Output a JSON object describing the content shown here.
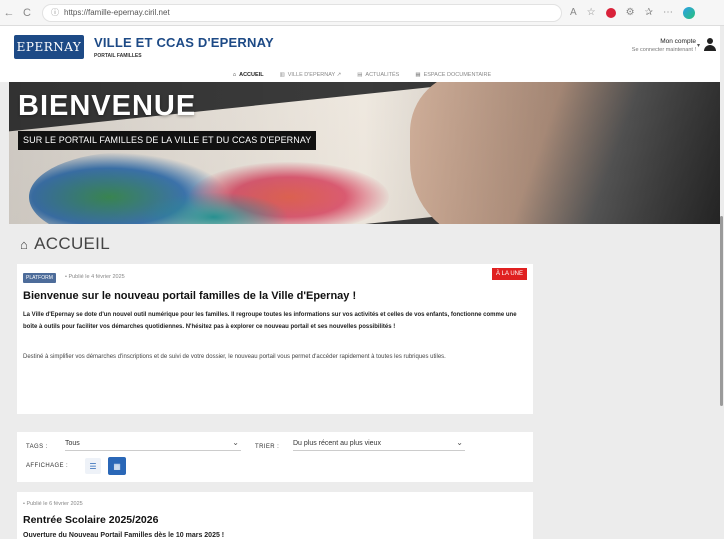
{
  "browser": {
    "url": "https://famille-epernay.ciril.net",
    "back_icon": "arrow-left",
    "reload_icon": "reload",
    "lock_icon": "site-info"
  },
  "header": {
    "logo_text": "EPERNAY",
    "title": "VILLE ET CCAS D'EPERNAY",
    "subtitle": "PORTAIL FAMILLES",
    "account_label": "Mon compte",
    "account_sub": "Se connecter maintenant !"
  },
  "nav": {
    "items": [
      {
        "icon": "⌂",
        "label": "ACCUEIL",
        "active": true
      },
      {
        "icon": "▥",
        "label": "VILLE D'EPERNAY ↗"
      },
      {
        "icon": "▤",
        "label": "ACTUALITÉS"
      },
      {
        "icon": "▦",
        "label": "ESPACE DOCUMENTAIRE"
      }
    ]
  },
  "hero": {
    "title": "BIENVENUE",
    "subtitle": "SUR LE PORTAIL FAMILLES DE LA VILLE ET DU CCAS D'EPERNAY"
  },
  "page": {
    "title": "ACCUEIL"
  },
  "news": [
    {
      "badge": "PLATFORM",
      "published": "• Publié le 4 février 2025",
      "flag": "À LA UNE",
      "title": "Bienvenue sur le nouveau portail familles de la Ville d'Epernay !",
      "lead": "La Ville d'Epernay se dote d'un nouvel outil numérique pour les familles. Il regroupe toutes les informations sur vos activités et celles de vos enfants, fonctionne comme une boîte à outils pour faciliter vos démarches quotidiennes. N'hésitez pas à explorer ce nouveau portail et ses nouvelles possibilités !",
      "body": "Destiné à simplifier vos démarches d'inscriptions et de suivi de votre dossier, le nouveau portail vous permet d'accéder rapidement à toutes les rubriques utiles."
    },
    {
      "published": "• Publié le 6 février 2025",
      "title": "Rentrée Scolaire 2025/2026",
      "lead": "Ouverture du Nouveau Portail Familles dès le 10 mars 2025 !"
    }
  ],
  "filters": {
    "tags_label": "TAGS :",
    "tags_value": "Tous",
    "sort_label": "TRIER :",
    "sort_value": "Du plus récent au plus vieux",
    "display_label": "AFFICHAGE :",
    "active_view": "grid"
  }
}
